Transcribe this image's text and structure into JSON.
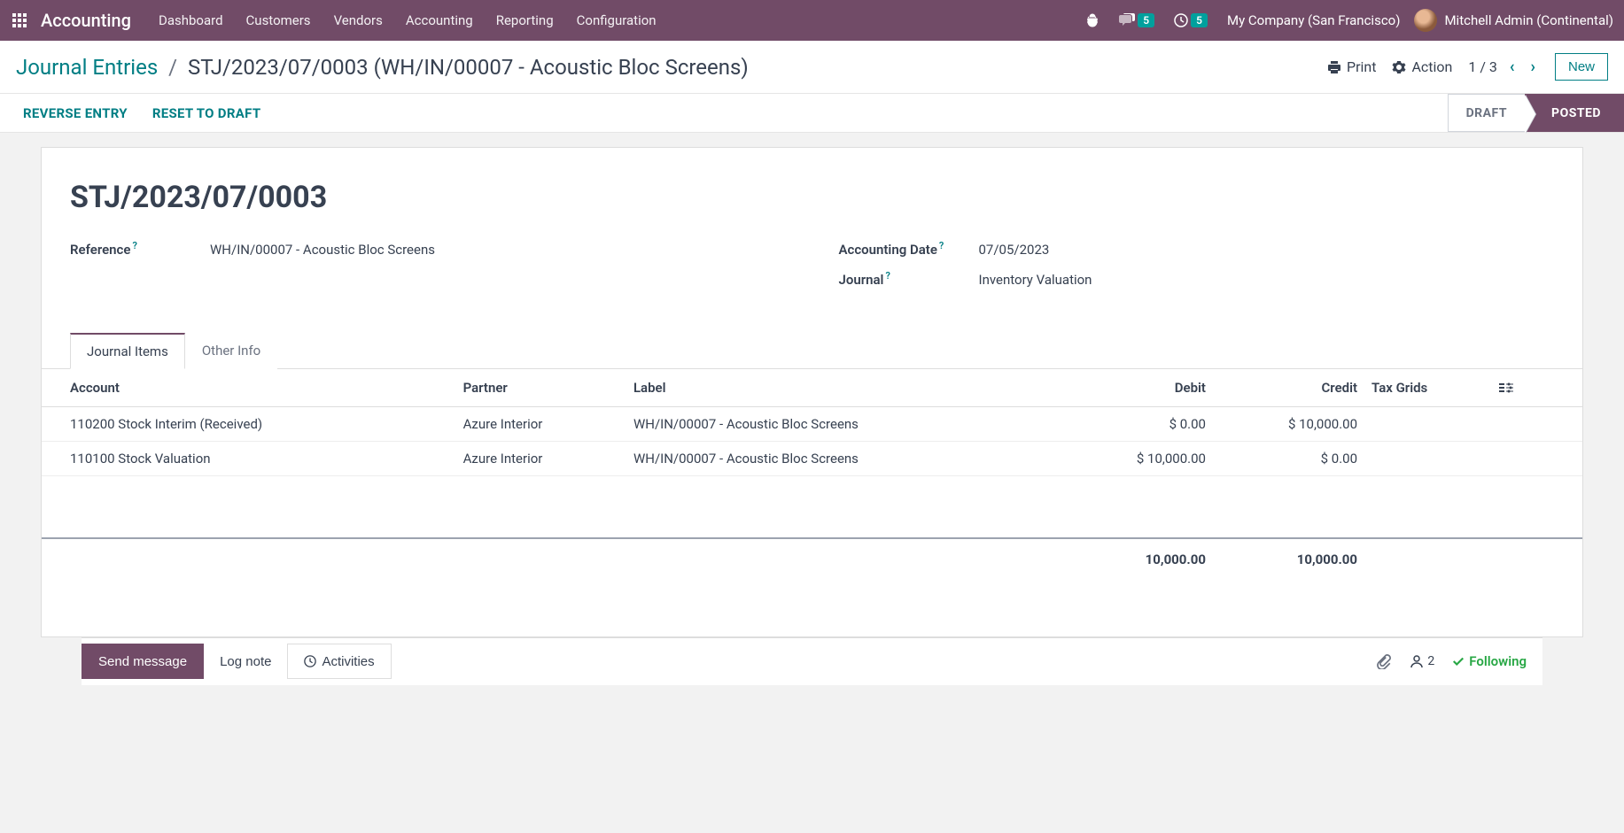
{
  "nav": {
    "brand": "Accounting",
    "links": [
      "Dashboard",
      "Customers",
      "Vendors",
      "Accounting",
      "Reporting",
      "Configuration"
    ],
    "msg_badge": "5",
    "act_badge": "5",
    "company": "My Company (San Francisco)",
    "user": "Mitchell Admin (Continental)"
  },
  "breadcrumb": {
    "root": "Journal Entries",
    "current": "STJ/2023/07/0003 (WH/IN/00007 - Acoustic Bloc Screens)"
  },
  "controls": {
    "print": "Print",
    "action": "Action",
    "pager": "1 / 3",
    "new": "New"
  },
  "statusbar": {
    "reverse": "REVERSE ENTRY",
    "reset": "RESET TO DRAFT",
    "draft": "DRAFT",
    "posted": "POSTED"
  },
  "record": {
    "title": "STJ/2023/07/0003",
    "reference_label": "Reference",
    "reference": "WH/IN/00007 - Acoustic Bloc Screens",
    "date_label": "Accounting Date",
    "date": "07/05/2023",
    "journal_label": "Journal",
    "journal": "Inventory Valuation"
  },
  "tabs": {
    "items": "Journal Items",
    "other": "Other Info"
  },
  "table": {
    "headers": {
      "account": "Account",
      "partner": "Partner",
      "label": "Label",
      "debit": "Debit",
      "credit": "Credit",
      "taxgrids": "Tax Grids"
    },
    "rows": [
      {
        "account": "110200 Stock Interim (Received)",
        "partner": "Azure Interior",
        "label": "WH/IN/00007 - Acoustic Bloc Screens",
        "debit": "$ 0.00",
        "credit": "$ 10,000.00"
      },
      {
        "account": "110100 Stock Valuation",
        "partner": "Azure Interior",
        "label": "WH/IN/00007 - Acoustic Bloc Screens",
        "debit": "$ 10,000.00",
        "credit": "$ 0.00"
      }
    ],
    "totals": {
      "debit": "10,000.00",
      "credit": "10,000.00"
    }
  },
  "chatter": {
    "send": "Send message",
    "log": "Log note",
    "activities": "Activities",
    "followers": "2",
    "following": "Following"
  }
}
